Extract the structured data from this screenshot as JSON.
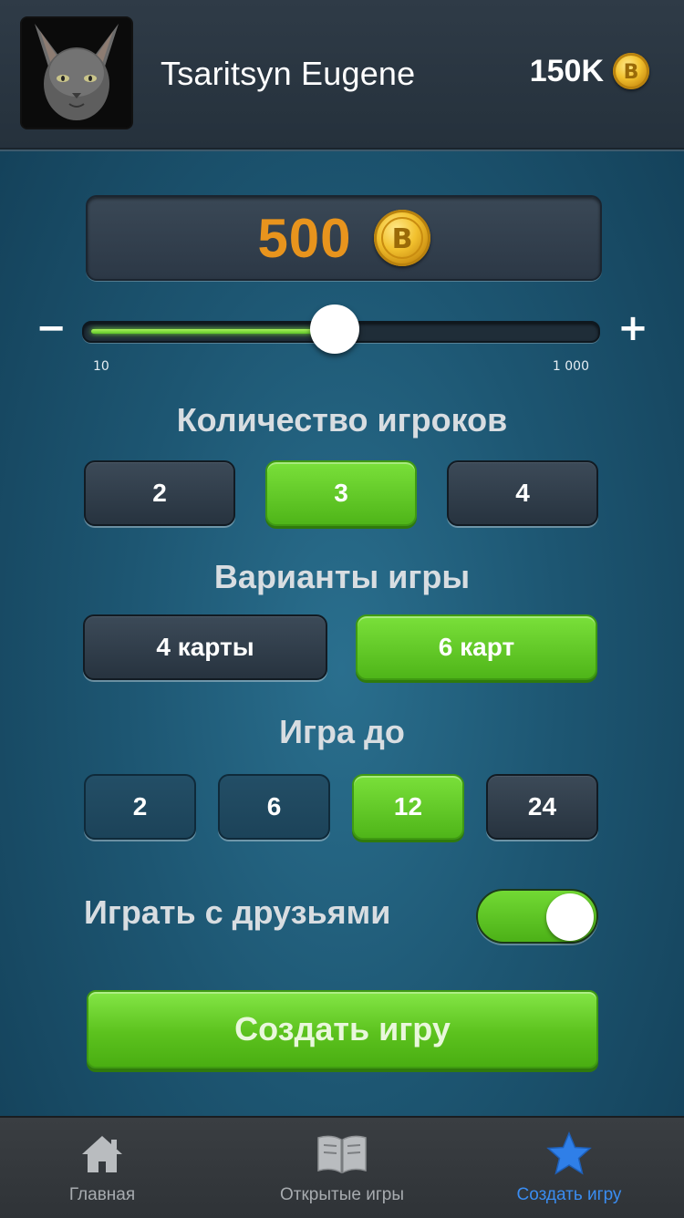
{
  "header": {
    "user_name": "Tsaritsyn Eugene",
    "balance": "150K",
    "balance_icon": "coin-icon",
    "avatar": "sphynx-cat-avatar"
  },
  "bet": {
    "value": "500",
    "slider_min": "10",
    "slider_max": "1 000",
    "slider_fraction": 0.49,
    "minus_label": "−",
    "plus_label": "+"
  },
  "players": {
    "title": "Количество игроков",
    "options": [
      "2",
      "3",
      "4"
    ],
    "selected": "3"
  },
  "variants": {
    "title": "Варианты игры",
    "options": [
      "4 карты",
      "6 карт"
    ],
    "selected": "6 карт"
  },
  "play_to": {
    "title": "Игра до",
    "options": [
      "2",
      "6",
      "12",
      "24"
    ],
    "selected": "12"
  },
  "friends": {
    "label": "Играть с друзьями",
    "enabled": true
  },
  "create_button": "Создать игру",
  "tabbar": {
    "items": [
      {
        "label": "Главная",
        "icon": "home-icon",
        "active": false
      },
      {
        "label": "Открытые игры",
        "icon": "book-icon",
        "active": false
      },
      {
        "label": "Создать игру",
        "icon": "star-icon",
        "active": true
      }
    ]
  },
  "colors": {
    "accent_green": "#5ec62a",
    "bet_orange": "#e8941d",
    "active_tab_blue": "#3a8df2"
  }
}
